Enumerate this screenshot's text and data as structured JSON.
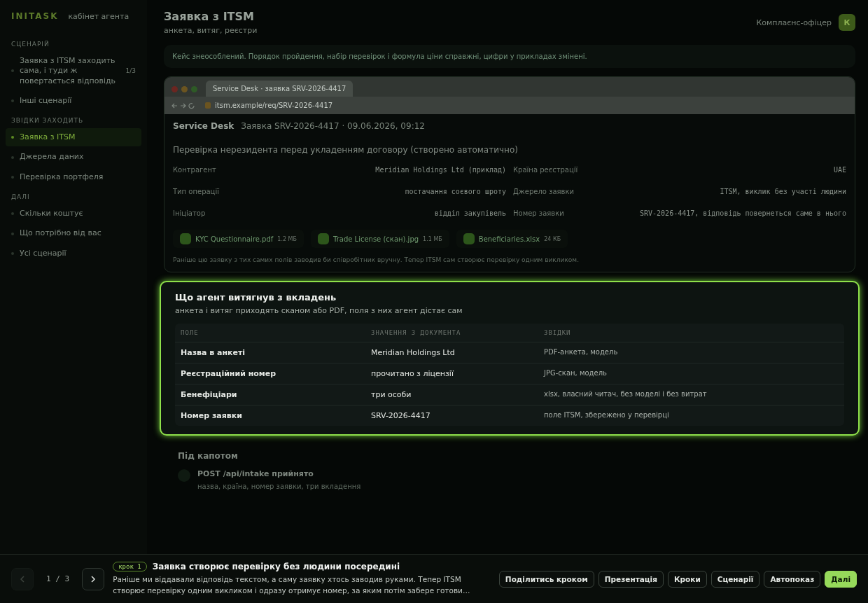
{
  "sidebar": {
    "logo": "INITASK",
    "subtitle": "кабінет агента",
    "sections": [
      {
        "title": "СЦЕНАРІЙ",
        "items": [
          {
            "label": "Заявка з ITSM заходить сама, і туди ж повертається відповідь",
            "count": "1/3",
            "selected": false
          },
          {
            "label": "Інші сценарії",
            "selected": false
          }
        ]
      },
      {
        "title": "ЗВІДКИ ЗАХОДИТЬ",
        "items": [
          {
            "label": "Заявка з ITSM",
            "selected": true
          },
          {
            "label": "Джерела даних",
            "selected": false
          },
          {
            "label": "Перевірка портфеля",
            "selected": false
          }
        ]
      },
      {
        "title": "ДАЛІ",
        "items": [
          {
            "label": "Скільки коштує",
            "selected": false
          },
          {
            "label": "Що потрібно від вас",
            "selected": false
          },
          {
            "label": "Усі сценарії",
            "selected": false
          }
        ]
      }
    ]
  },
  "header": {
    "title": "Заявка з ITSM",
    "subtitle": "анкета, витяг, реєстри",
    "user": "Комплаєнс-офіцер",
    "avatar": "К"
  },
  "notice": "Кейс знеособлений. Порядок пройдення, набір перевірок і формула ціни справжні, цифри у прикладах змінені.",
  "browser": {
    "tab": "Service Desk · заявка SRV-2026-4417",
    "url": "itsm.example/req/SRV-2026-4417",
    "app": "Service Desk",
    "meta": "Заявка SRV-2026-4417 · 09.06.2026, 09:12",
    "subject": "Перевірка нерезидента перед укладенням договору (створено автоматично)",
    "fields": [
      {
        "label": "Контрагент",
        "value": "Meridian Holdings Ltd (приклад)"
      },
      {
        "label": "Країна реєстрації",
        "value": "UAE"
      },
      {
        "label": "Тип операції",
        "value": "постачання соєвого шроту"
      },
      {
        "label": "Джерело заявки",
        "value": "ITSM, виклик без участі людини"
      },
      {
        "label": "Ініціатор",
        "value": "відділ закупівель"
      },
      {
        "label": "Номер заявки",
        "value": "SRV-2026-4417, відповідь повернеться саме в нього"
      }
    ],
    "attachments": [
      {
        "name": "KYC Questionnaire.pdf",
        "size": "1.2 МБ"
      },
      {
        "name": "Trade License (скан).jpg",
        "size": "1.1 МБ"
      },
      {
        "name": "Beneficiaries.xlsx",
        "size": "24 КБ"
      }
    ],
    "footnote": "Раніше цю заявку з тих самих полів заводив би співробітник вручну. Тепер ITSM сам створює перевірку одним викликом."
  },
  "extracted": {
    "title": "Що агент витягнув з вкладень",
    "subtitle": "анкета і витяг приходять сканом або PDF, поля з них агент дістає сам",
    "columns": [
      "ПОЛЕ",
      "ЗНАЧЕННЯ З ДОКУМЕНТА",
      "ЗВІДКИ"
    ],
    "rows": [
      [
        "Назва в анкеті",
        "Meridian Holdings Ltd",
        "PDF-анкета, модель"
      ],
      [
        "Реєстраційний номер",
        "прочитано з ліцензії",
        "JPG-скан, модель"
      ],
      [
        "Бенефіціари",
        "три особи",
        "xlsx, власний читач, без моделі і без витрат"
      ],
      [
        "Номер заявки",
        "SRV-2026-4417",
        "поле ITSM, збережено у перевірці"
      ]
    ]
  },
  "under_hood": {
    "title": "Під капотом",
    "steps": [
      {
        "title": "POST /api/intake прийнято",
        "detail": "назва, країна, номер заявки, три вкладення"
      }
    ]
  },
  "footer": {
    "prev_disabled": true,
    "counter": "1 / 3",
    "step_badge": "крок 1",
    "title": "Заявка створює перевірку без людини посередині",
    "text": "Раніше ми віддавали відповідь текстом, а саму заявку хтось заводив руками. Тепер ITSM створює перевірку одним викликом і одразу отримує номер, за яким потім забере готови…",
    "buttons": [
      {
        "label": "Поділитись кроком",
        "kind": "outline"
      },
      {
        "label": "Презентація",
        "kind": "outline"
      },
      {
        "label": "Кроки",
        "kind": "outline"
      },
      {
        "label": "Сценарії",
        "kind": "outline"
      },
      {
        "label": "Автопоказ",
        "kind": "outline"
      },
      {
        "label": "Далі",
        "kind": "primary"
      }
    ]
  }
}
